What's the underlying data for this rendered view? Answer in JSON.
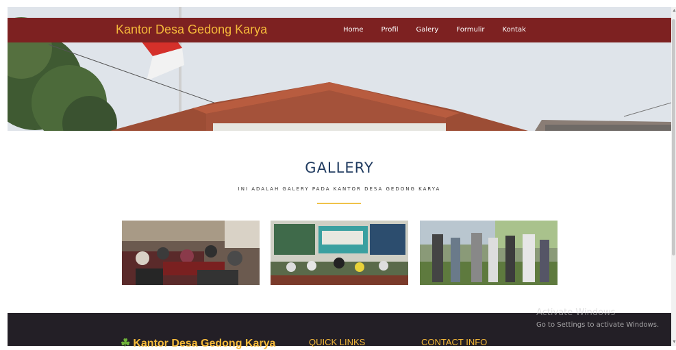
{
  "navbar": {
    "brand": "Kantor Desa Gedong Karya",
    "links": [
      "Home",
      "Profil",
      "Galery",
      "Formulir",
      "Kontak"
    ]
  },
  "gallery": {
    "title": "GALLERY",
    "subtitle": "INI ADALAH GALERY PADA KANTOR DESA GEDONG KARYA"
  },
  "footer": {
    "brand": "Kantor Desa Gedong Karya",
    "quick_links": "QUICK LINKS",
    "contact_info": "CONTACT INFO"
  },
  "watermark": {
    "title": "Activate Windows",
    "subtitle": "Go to Settings to activate Windows."
  },
  "colors": {
    "navbar": "#7d2121",
    "brand": "#f5b93a",
    "title": "#1f3a5f",
    "footer": "#231f26",
    "divider": "#f0c24a"
  }
}
